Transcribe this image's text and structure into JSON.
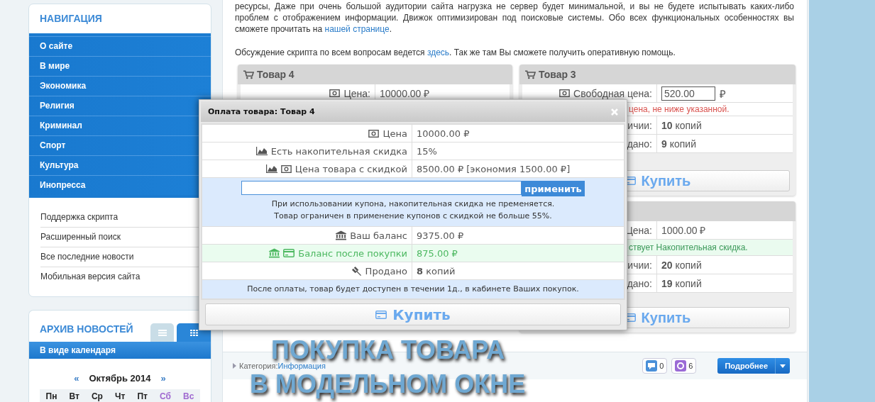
{
  "sidebar": {
    "navigation": {
      "title": "НАВИГАЦИЯ",
      "items": [
        "О сайте",
        "В мире",
        "Экономика",
        "Религия",
        "Криминал",
        "Спорт",
        "Культура",
        "Инопресса"
      ],
      "links": [
        "Поддержка скрипта",
        "Расширенный поиск",
        "Все последние новости",
        "Мобильная версия сайта"
      ]
    },
    "archive": {
      "title": "АРХИВ НОВОСТЕЙ",
      "tabs": [
        {
          "kind": "list",
          "selected": false
        },
        {
          "kind": "grid",
          "selected": true
        }
      ],
      "bar": "В виде календаря",
      "calendar": {
        "prev": "«",
        "month": "Октябрь 2014",
        "next": "»",
        "weekdays": [
          {
            "label": "Пн",
            "weekend": false
          },
          {
            "label": "Вт",
            "weekend": false
          },
          {
            "label": "Ср",
            "weekend": false
          },
          {
            "label": "Чт",
            "weekend": false
          },
          {
            "label": "Пт",
            "weekend": false
          },
          {
            "label": "Сб",
            "weekend": true
          },
          {
            "label": "Вс",
            "weekend": true
          }
        ]
      }
    }
  },
  "article": {
    "paragraphs": [
      {
        "before": "ресурсы, Даже при очень большой аудитории сайта нагрузка не сервер будет минимальной, и вы не будете испытывать каких-либо проблем с отображением информации. Движок оптимизирован под поисковые системы. Обо всех функциональных особенностях вы сможете прочитать на ",
        "link": "нашей странице",
        "after": "."
      },
      {
        "before": "Обсуждение скрипта по всем вопросам ведется ",
        "link": "здесь",
        "after": ". Так же там Вы сможете получить оперативную помощь."
      }
    ],
    "columns": [
      [
        {
          "title": "Товар 4",
          "rows": [
            {
              "kind": "price",
              "label": "Цена:",
              "value": "10000.00 ₽"
            }
          ]
        }
      ],
      [
        {
          "title": "Товар 3",
          "rows": [
            {
              "kind": "free_price",
              "label": "Свободная цена:",
              "value": "520.00",
              "currency": "₽"
            },
            {
              "kind": "warning",
              "text": "цена, не ниже указанной."
            },
            {
              "kind": "stat",
              "label": "ичии:",
              "value": "**10** копий"
            },
            {
              "kind": "stat",
              "label": "дано:",
              "value": "**9** копий"
            }
          ],
          "buy": "Купить"
        },
        {
          "rows": [
            {
              "kind": "price",
              "label": "Цена:",
              "value": "1000.00 ₽"
            },
            {
              "kind": "bonus",
              "text": "ствует Накопительная скидка."
            },
            {
              "kind": "stat",
              "label": "ичии:",
              "value": "**20** копий"
            },
            {
              "kind": "stat",
              "label": "дано:",
              "value": "**19** копий"
            }
          ],
          "buy": "Купить"
        }
      ]
    ],
    "footer": {
      "category_label": "Категория:",
      "category": "Информация",
      "comments": "0",
      "reposts": "6",
      "more": "Подробнее"
    }
  },
  "caption": [
    "ПОКУПКА ТОВАРА",
    "В МОДЕЛЬНОМ ОКНЕ"
  ],
  "modal": {
    "title": "Оплата товара: Товар 4",
    "rows": [
      {
        "kind": "price",
        "label": "Цена",
        "value": "10000.00 ₽"
      },
      {
        "kind": "discount",
        "label": "Есть накопительная скидка",
        "value": "15%"
      },
      {
        "kind": "discount_price",
        "label": "Цена товара с скидкой",
        "value": "8500.00 ₽ [экономия 1500.00 ₽]"
      },
      {
        "kind": "coupon",
        "button": "применить",
        "notes": [
          "При использовании купона, накопительная скидка не пременяется.",
          "Товар ограничен в применение купонов с скидкой не больше 55%."
        ]
      },
      {
        "kind": "balance",
        "label": "Ваш баланс",
        "value": "9375.00 ₽"
      },
      {
        "kind": "balance_after",
        "label": "Баланс после покупки",
        "value": "875.00 ₽"
      },
      {
        "kind": "sold",
        "label": "Продано",
        "value": "**8** копий"
      },
      {
        "kind": "notice",
        "text": "После оплаты, товар будет доступен в течении 1д., в кабинете Ваших покупок."
      }
    ],
    "buy": "Купить"
  }
}
